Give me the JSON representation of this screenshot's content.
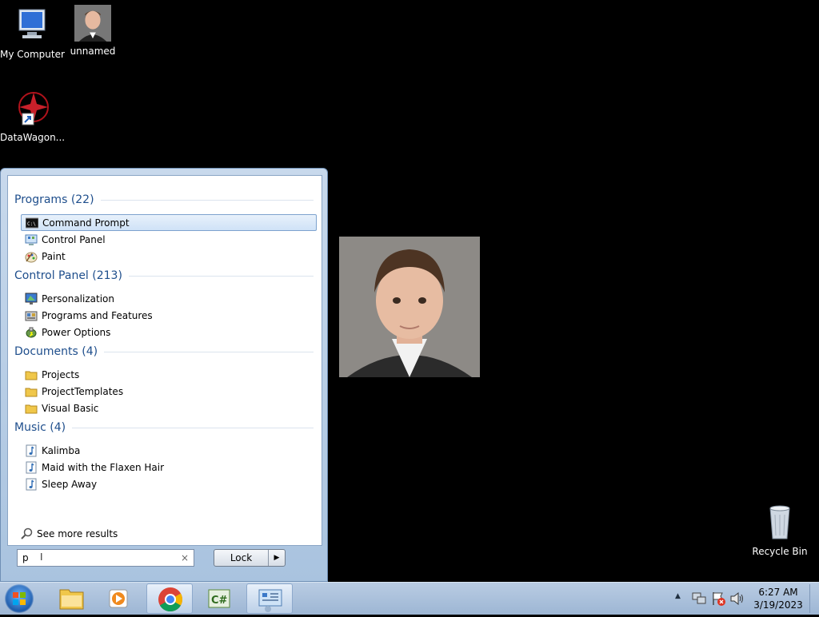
{
  "desktop": {
    "icons": [
      {
        "label": "My Computer"
      },
      {
        "label": "unnamed"
      },
      {
        "label": "DataWagon..."
      },
      {
        "label": "Recycle Bin"
      }
    ]
  },
  "start_menu": {
    "groups": [
      {
        "header": "Programs (22)",
        "items": [
          "Command Prompt",
          "Control Panel",
          "Paint"
        ]
      },
      {
        "header": "Control Panel (213)",
        "items": [
          "Personalization",
          "Programs and Features",
          "Power Options"
        ]
      },
      {
        "header": "Documents (4)",
        "items": [
          "Projects",
          "ProjectTemplates",
          "Visual Basic"
        ]
      },
      {
        "header": "Music (4)",
        "items": [
          "Kalimba",
          "Maid with the Flaxen Hair",
          "Sleep Away"
        ]
      }
    ],
    "see_more": "See more results",
    "search_value": "p",
    "clear_glyph": "×",
    "lock_label": "Lock",
    "lock_arrow": "▶"
  },
  "taskbar": {
    "time": "6:27 AM",
    "date": "3/19/2023",
    "tray_arrow": "▲"
  },
  "colors": {
    "group_header": "#1e4e8c",
    "selection_border": "#7da2ce"
  }
}
